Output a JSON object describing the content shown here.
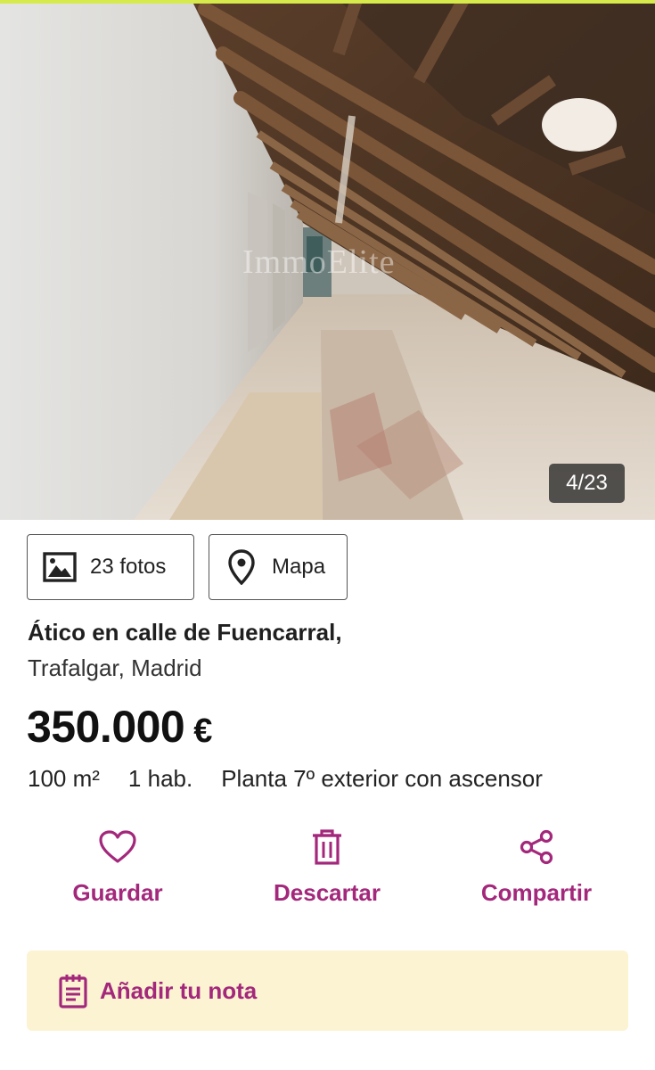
{
  "colors": {
    "accent": "#a3287b",
    "note_bg": "#fcf3d2",
    "top_strip": "#d6ea4c"
  },
  "gallery": {
    "watermark": "ImmoElite",
    "counter": "4/23"
  },
  "media": {
    "photos_label": "23 fotos",
    "photos_icon": "image-icon",
    "map_label": "Mapa",
    "map_icon": "location-pin-icon"
  },
  "listing": {
    "title": "Ático en calle de Fuencarral,",
    "location": "Trafalgar, Madrid",
    "price": "350.000",
    "currency": "€",
    "features": [
      "100 m²",
      "1 hab.",
      "Planta 7º exterior con ascensor"
    ]
  },
  "actions": {
    "save_label": "Guardar",
    "save_icon": "heart-icon",
    "discard_label": "Descartar",
    "discard_icon": "trash-icon",
    "share_label": "Compartir",
    "share_icon": "share-icon"
  },
  "note": {
    "label": "Añadir tu nota",
    "icon": "notepad-icon"
  }
}
